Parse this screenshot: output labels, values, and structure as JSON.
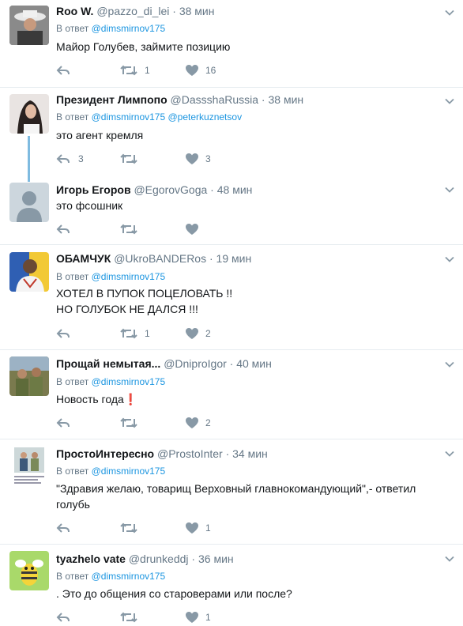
{
  "tweets": [
    {
      "name": "Roo W.",
      "handle": "@pazzo_di_lei",
      "time": "38 мин",
      "reply_prefix": "В ответ",
      "reply_to": [
        "@dimsmirnov175"
      ],
      "lines": [
        "Майор Голубев, займите позицию"
      ],
      "retweets": "1",
      "likes": "16"
    },
    {
      "name": "Президент Лимпопо",
      "handle": "@DassshaRussia",
      "time": "38 мин",
      "reply_prefix": "В ответ",
      "reply_to": [
        "@dimsmirnov175",
        "@peterkuznetsov"
      ],
      "lines": [
        "это агент кремля"
      ],
      "replies": "3",
      "likes": "3"
    },
    {
      "name": "Игорь Егоров",
      "handle": "@EgorovGoga",
      "time": "48 мин",
      "lines": [
        "это фсошник"
      ]
    },
    {
      "name": "ОБАМЧУК",
      "handle": "@UkroBANDERos",
      "time": "19 мин",
      "reply_prefix": "В ответ",
      "reply_to": [
        "@dimsmirnov175"
      ],
      "lines": [
        "ХОТЕЛ В ПУПОК ПОЦЕЛОВАТЬ !!",
        "НО ГОЛУБОК НЕ ДАЛСЯ !!!"
      ],
      "retweets": "1",
      "likes": "2"
    },
    {
      "name": "Прощай немытая...",
      "handle": "@DniproIgor",
      "time": "40 мин",
      "reply_prefix": "В ответ",
      "reply_to": [
        "@dimsmirnov175"
      ],
      "lines": [
        "Новость года❗"
      ],
      "likes": "2"
    },
    {
      "name": "ПростоИнтересно",
      "handle": "@ProstoInter",
      "time": "34 мин",
      "reply_prefix": "В ответ",
      "reply_to": [
        "@dimsmirnov175"
      ],
      "lines": [
        "\"Здравия желаю, товарищ Верховный главнокомандующий\",- ответил",
        "голубь"
      ],
      "likes": "1"
    },
    {
      "name": "tyazhelo vate",
      "handle": "@drunkeddj",
      "time": "36 мин",
      "reply_prefix": "В ответ",
      "reply_to": [
        "@dimsmirnov175"
      ],
      "lines": [
        ". Это до общения со староверами или после?"
      ],
      "likes": "1"
    }
  ],
  "colors": {
    "link": "#1b95e0",
    "meta": "#657786",
    "separator": "#e6ecf0",
    "thread": "#7fbbe0"
  },
  "icons": [
    "reply-icon",
    "retweet-icon",
    "heart-icon",
    "chevron-down-icon"
  ]
}
